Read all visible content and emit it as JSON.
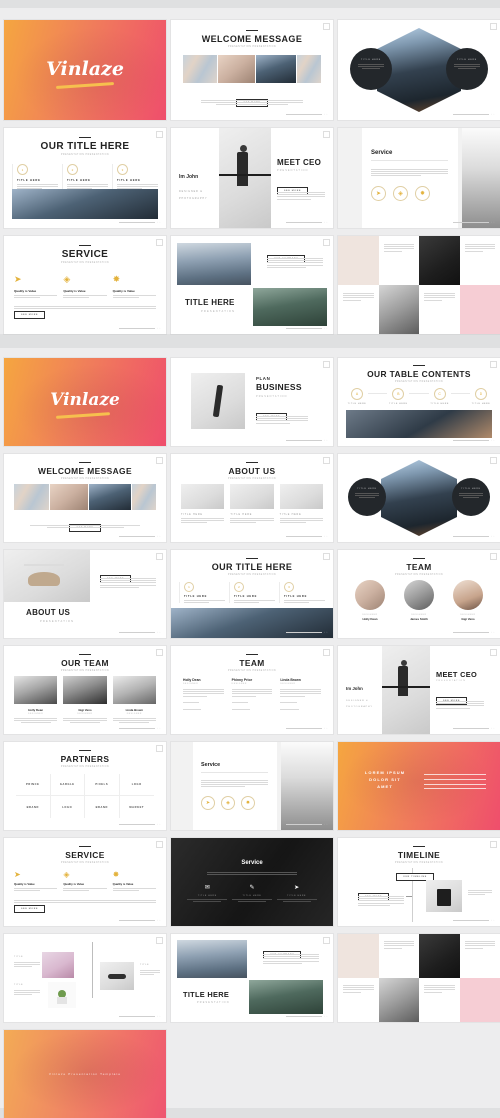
{
  "meta": {
    "brand": "Vinlaze",
    "background_color": "#dfe0e1",
    "accent_gradient_from": "#f5a640",
    "accent_gradient_to": "#ef4e6c",
    "gold": "#e3b23c",
    "ink": "#222222"
  },
  "block_a": {
    "slides": [
      {
        "id": "a1",
        "kind": "cover",
        "brand": "Vinlaze"
      },
      {
        "id": "a2",
        "kind": "welcome",
        "title": "WELCOME MESSAGE",
        "sub": "PRESENTATION PRESENTATION",
        "kicker": "VINLAZE",
        "button": "GET MORE"
      },
      {
        "id": "a3",
        "kind": "hexagon",
        "left_label": "TITLE HERE",
        "right_label": "TITLE HERE"
      },
      {
        "id": "a4",
        "kind": "three-circles",
        "title": "OUR TITLE HERE",
        "sub": "PRESENTATION PRESENTATION",
        "kicker": "VINLAZE",
        "items": [
          {
            "label": "TITLE HERE"
          },
          {
            "label": "TITLE HERE"
          },
          {
            "label": "TITLE HERE"
          }
        ]
      },
      {
        "id": "a5",
        "kind": "meet-ceo",
        "title": "MEET CEO",
        "sub": "PRESENTATION",
        "name": "Im John",
        "role1": "DESIGNER &",
        "role2": "PHOTOGRAPHY",
        "button": "SEE MORE"
      },
      {
        "id": "a6",
        "kind": "service-vert",
        "watermark": "SERVICE",
        "title": "Service",
        "sub": "Lorem ipsum dolor sit amet consectetur adipiscing"
      },
      {
        "id": "a7",
        "kind": "service-3",
        "title": "SERVICE",
        "sub": "PRESENTATION PRESENTATION",
        "kicker": "VINLAZE",
        "items": [
          {
            "label": "Quality is Value"
          },
          {
            "label": "Quality is Value"
          },
          {
            "label": "Quality is Value"
          }
        ],
        "button": "SEE MORE"
      },
      {
        "id": "a8",
        "kind": "title-here",
        "title": "TITLE HERE",
        "sub": "PRESENTATION",
        "tag": "OUR SUMMARY"
      },
      {
        "id": "a9",
        "kind": "portfolio-grid"
      }
    ]
  },
  "block_b": {
    "slides": [
      {
        "id": "b1",
        "kind": "cover",
        "brand": "Vinlaze"
      },
      {
        "id": "b2",
        "kind": "plan-business",
        "title1": "PLAN",
        "title2": "BUSINESS",
        "sub": "PRESENTATION",
        "button": "SEE MORE"
      },
      {
        "id": "b3",
        "kind": "table-contents",
        "title": "OUR TABLE CONTENTS",
        "sub": "PRESENTATION PRESENTATION",
        "kicker": "VINLAZE",
        "steps": [
          {
            "num": "A",
            "label": "TITLE HERE"
          },
          {
            "num": "B",
            "label": "TITLE HERE"
          },
          {
            "num": "C",
            "label": "TITLE HERE"
          },
          {
            "num": "D",
            "label": "TITLE HERE"
          }
        ]
      },
      {
        "id": "b4",
        "kind": "welcome",
        "title": "WELCOME MESSAGE",
        "sub": "PRESENTATION PRESENTATION",
        "kicker": "VINLAZE",
        "button": "GET MORE"
      },
      {
        "id": "b5",
        "kind": "about-us-3",
        "title": "ABOUT US",
        "sub": "PRESENTATION PRESENTATION",
        "kicker": "VINLAZE",
        "items": [
          {
            "label": "TITLE HERE"
          },
          {
            "label": "TITLE HERE"
          },
          {
            "label": "TITLE HERE"
          }
        ]
      },
      {
        "id": "b6",
        "kind": "hexagon",
        "left_label": "TITLE HERE",
        "right_label": "TITLE HERE"
      },
      {
        "id": "b7",
        "kind": "about-us-left",
        "title": "ABOUT US",
        "sub": "PRESENTATION",
        "button": "SEE MORE"
      },
      {
        "id": "b8",
        "kind": "three-circles",
        "title": "OUR TITLE HERE",
        "sub": "PRESENTATION PRESENTATION",
        "kicker": "VINLAZE",
        "items": [
          {
            "label": "TITLE HERE"
          },
          {
            "label": "TITLE HERE"
          },
          {
            "label": "TITLE HERE"
          }
        ]
      },
      {
        "id": "b9",
        "kind": "team-circles",
        "title": "TEAM",
        "sub": "PRESENTATION PRESENTATION",
        "kicker": "VINLAZE",
        "members": [
          {
            "name": "Holly Dean",
            "role": "DESIGNER"
          },
          {
            "name": "James Smith",
            "role": "DESIGNER"
          },
          {
            "name": "Gigi Vano",
            "role": "DESIGNER"
          }
        ]
      },
      {
        "id": "b10",
        "kind": "our-team",
        "title": "OUR TEAM",
        "sub": "PRESENTATION PRESENTATION",
        "kicker": "VINLAZE",
        "members": [
          {
            "name": "Holly Dean",
            "role": "DESIGNER"
          },
          {
            "name": "Gigi Vano",
            "role": "DESIGNER"
          },
          {
            "name": "Linda Brown",
            "role": "DESIGNER"
          }
        ]
      },
      {
        "id": "b11",
        "kind": "team-list",
        "title": "TEAM",
        "sub": "PRESENTATION PRESENTATION",
        "kicker": "VINLAZE",
        "members": [
          {
            "name": "Holly Dean",
            "role": "DESIGNER"
          },
          {
            "name": "Phinny Price",
            "role": "DESIGNER"
          },
          {
            "name": "Linda Brown",
            "role": "DESIGNER"
          }
        ]
      },
      {
        "id": "b12",
        "kind": "meet-ceo",
        "title": "MEET CEO",
        "sub": "PRESENTATION",
        "name": "Im John",
        "role1": "DESIGNER &",
        "role2": "PHOTOGRAPHY",
        "button": "SEE MORE"
      },
      {
        "id": "b13",
        "kind": "partners",
        "title": "PARTNERS",
        "sub": "PRESENTATION PRESENTATION",
        "kicker": "VINLAZE",
        "cells": [
          {
            "label": "PRINCE"
          },
          {
            "label": "GARGLE"
          },
          {
            "label": "PIXELS"
          },
          {
            "label": "LOGO"
          },
          {
            "label": "BRAND"
          },
          {
            "label": "LOGO"
          },
          {
            "label": "BRAND"
          },
          {
            "label": "MARKET"
          }
        ]
      },
      {
        "id": "b14",
        "kind": "service-vert",
        "watermark": "SERVICE",
        "title": "Service",
        "sub": "Lorem ipsum dolor sit amet consectetur adipiscing"
      },
      {
        "id": "b15",
        "kind": "gradient-quote",
        "line1": "LOREM IPSUM",
        "line2": "DOLOR SIT",
        "line3": "AMET"
      },
      {
        "id": "b16",
        "kind": "service-3",
        "title": "SERVICE",
        "sub": "PRESENTATION PRESENTATION",
        "kicker": "VINLAZE",
        "items": [
          {
            "label": "Quality is Value"
          },
          {
            "label": "Quality is Value"
          },
          {
            "label": "Quality is Value"
          }
        ],
        "button": "SEE MORE"
      },
      {
        "id": "b17",
        "kind": "service-dark",
        "title": "Service",
        "items": [
          {
            "icon": "mail-icon",
            "label": "TITLE HERE"
          },
          {
            "icon": "pencil-icon",
            "label": "TITLE HERE"
          },
          {
            "icon": "paper-plane-icon",
            "label": "TITLE HERE"
          }
        ]
      },
      {
        "id": "b18",
        "kind": "timeline",
        "title": "TIMELINE",
        "sub": "PRESENTATION PRESENTATION",
        "kicker": "VINLAZE",
        "tag_top": "OUR TIMELINE",
        "tag_mid": "SEE MORE"
      },
      {
        "id": "b19",
        "kind": "infographic",
        "label1": "TITLE",
        "label2": "TITLE",
        "label3": "TITLE"
      },
      {
        "id": "b20",
        "kind": "title-here",
        "title": "TITLE HERE",
        "sub": "PRESENTATION",
        "tag": "OUR SUMMARY"
      },
      {
        "id": "b21",
        "kind": "portfolio-grid"
      },
      {
        "id": "b22",
        "kind": "cover-end",
        "caption": "Vinlaze Presentation Template"
      }
    ]
  }
}
